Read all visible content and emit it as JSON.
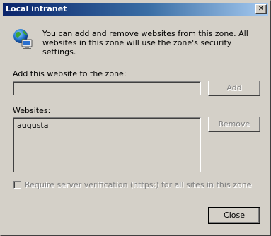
{
  "window": {
    "title": "Local intranet",
    "close_glyph": "✕"
  },
  "info": {
    "icon": "intranet-globe-icon",
    "text": "You can add and remove websites from this zone. All websites in this zone will use the zone's security settings."
  },
  "add_site": {
    "label": "Add this website to the zone:",
    "value": "",
    "add_button_label": "Add",
    "add_button_enabled": false
  },
  "websites": {
    "label": "Websites:",
    "items": [
      "augusta"
    ],
    "remove_button_label": "Remove",
    "remove_button_enabled": false
  },
  "require_https": {
    "label": "Require server verification (https:) for all sites in this zone",
    "checked": false,
    "enabled": false
  },
  "footer": {
    "close_button_label": "Close"
  },
  "colors": {
    "title_gradient_start": "#0a246a",
    "title_gradient_end": "#a6caf0",
    "dialog_face": "#d4d0c8",
    "disabled_text": "#808080"
  }
}
